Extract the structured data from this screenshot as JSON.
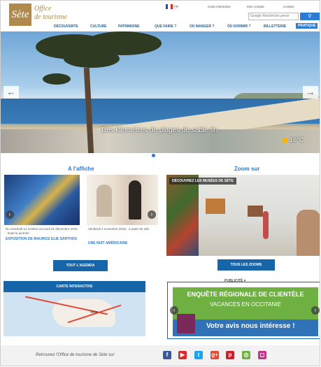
{
  "header": {
    "logo_mark": "Sète",
    "logo_line1": "Office",
    "logo_line2": "de tourisme",
    "language": "FR",
    "top_links": [
      "Carte interactive",
      "Mon compte",
      "Contact"
    ],
    "search_placeholder": "Google Recherche perso",
    "nav": [
      "DÉCOUVERTE",
      "CULTURE",
      "PATRIMOINE",
      "QUE FAIRE ?",
      "OÙ MANGER ?",
      "OÙ DORMIR ?",
      "BILLETTERIE",
      "PRATIQUE"
    ],
    "nav_active_index": 7
  },
  "hero": {
    "caption": "Des kilomètres de plages de sable fin",
    "temperature": "16°C"
  },
  "affiche": {
    "title": "A l'affiche",
    "cards": [
      {
        "caption": "Du vendredi 14 octobre au lundi 31 décembre 2016 - toute la journée",
        "title": "EXPOSITION DE MAURICE ELIE SARTHOU"
      },
      {
        "caption": "Vendredi 4 novembre 2016 - à partir de 19h",
        "title": "UNE NUIT AMÉRICAINE"
      }
    ],
    "button": "TOUT L'AGENDA"
  },
  "zoom": {
    "title": "Zoom sur",
    "banner": "DÉCOUVREZ LES MUSÉES DE SÈTE",
    "button": "TOUS LES ZOOMS"
  },
  "map": {
    "title": "CARTE INTERACTIVE",
    "place": "Sète"
  },
  "publicite": {
    "label": "PUBLICITÉ",
    "line1": "ENQUÊTE RÉGIONALE DE CLIENTÈLE",
    "line2": "VACANCES EN OCCITANIE",
    "line3": "Votre avis nous intéresse !"
  },
  "footer": {
    "text": "Retrouvez l'Office de tourisme de Sète sur",
    "socials": [
      {
        "icon": "facebook-icon",
        "glyph": "f",
        "color": "#3b5998"
      },
      {
        "icon": "youtube-icon",
        "glyph": "▶",
        "color": "#d62b2b"
      },
      {
        "icon": "twitter-icon",
        "glyph": "t",
        "color": "#1da1f2"
      },
      {
        "icon": "googleplus-icon",
        "glyph": "g+",
        "color": "#dd4b39"
      },
      {
        "icon": "pinterest-icon",
        "glyph": "p",
        "color": "#cb2027"
      },
      {
        "icon": "tripadvisor-icon",
        "glyph": "◎",
        "color": "#6fb042"
      },
      {
        "icon": "instagram-icon",
        "glyph": "◻",
        "color": "#c13584"
      }
    ]
  }
}
